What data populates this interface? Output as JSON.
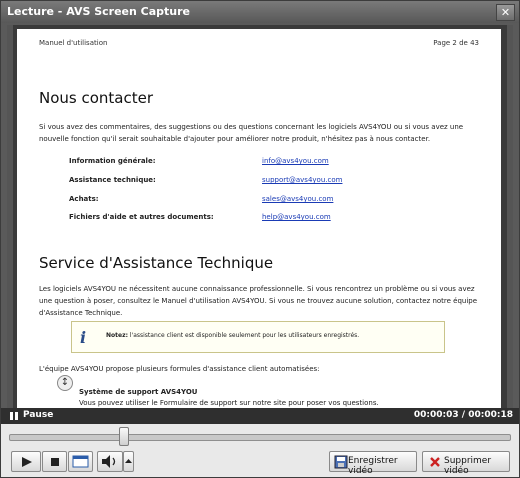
{
  "window": {
    "title": "Lecture - AVS Screen Capture",
    "close_glyph": "✕"
  },
  "document": {
    "header_left": "Manuel d'utilisation",
    "header_right": "Page 2 de  43",
    "section1_title": "Nous contacter",
    "section1_para": "Si vous avez des commentaires, des suggestions ou des questions concernant les logiciels AVS4YOU ou si vous avez une nouvelle fonction qu'il serait souhaitable d'ajouter pour améliorer notre produit, n'hésitez pas à nous contacter.",
    "contacts": [
      {
        "label": "Information générale:",
        "value": "info@avs4you.com"
      },
      {
        "label": "Assistance technique:",
        "value": "support@avs4you.com"
      },
      {
        "label": "Achats:",
        "value": "sales@avs4you.com"
      },
      {
        "label": "Fichiers d'aide et autres documents:",
        "value": "help@avs4you.com"
      }
    ],
    "section2_title": "Service d'Assistance Technique",
    "section2_para": "Les logiciels AVS4YOU ne nécessitent aucune connaissance professionnelle. Si vous rencontrez un problème ou si vous avez une question à poser, consultez le Manuel d'utilisation AVS4YOU. Si vous ne trouvez aucune solution, contactez notre équipe d'Assistance Technique.",
    "note_label": "Notez:",
    "note_text": " l'assistance client est disponible seulement pour les utilisateurs enregistrés.",
    "support_intro": "L'équipe AVS4YOU propose plusieurs formules d'assistance client automatisées:",
    "bullet_title": "Système de support AVS4YOU",
    "bullet_text": "Vous pouvez utiliser le Formulaire de support sur notre site pour poser vos questions."
  },
  "player": {
    "status": "Pause",
    "time": "00:00:03 / 00:00:18",
    "progress_fraction": 0.23,
    "save_label": "Enregistrer vidéo",
    "delete_label": "Supprimer vidéo"
  },
  "icons": {
    "play": "play-icon",
    "stop": "stop-icon",
    "window": "window-icon",
    "volume": "volume-icon",
    "save": "save-icon",
    "delete": "delete-icon",
    "note": "info-icon"
  },
  "colors": {
    "link": "#1a3bb5",
    "titlebar": "#6a6a6a",
    "delete_red": "#cc2222"
  }
}
